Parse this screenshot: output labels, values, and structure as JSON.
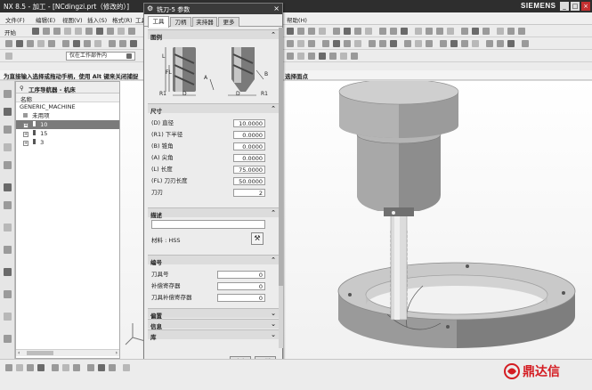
{
  "window": {
    "title": "NX 8.5 - 加工 - [NCdingzi.prt（修改的）]",
    "brand": "SIEMENS",
    "controls": [
      "_",
      "□",
      "×"
    ]
  },
  "menu": {
    "items": [
      "文件(F)",
      "编辑(E)",
      "视图(V)",
      "插入(S)",
      "格式(R)",
      "工具(T)"
    ],
    "help": "帮助(H)"
  },
  "toolbar": {
    "start_label": "开始",
    "selection_scope": "仅在工作部件内"
  },
  "status": {
    "prompt": "为直接输入选择或拖动手柄，使用 Alt 键来关闭捕捉",
    "prompt_right": "选择面点"
  },
  "navigator": {
    "title": "工序导航器 - 机床",
    "column_name": "名称",
    "rows": [
      {
        "label": "GENERIC_MACHINE",
        "expander": "",
        "flag": false,
        "selected": false,
        "indent": 0
      },
      {
        "label": "未用项",
        "expander": "",
        "flag": false,
        "selected": false,
        "indent": 4
      },
      {
        "label": "10",
        "expander": "+",
        "flag": true,
        "selected": true,
        "indent": 4
      },
      {
        "label": "15",
        "expander": "+",
        "flag": true,
        "selected": false,
        "indent": 4
      },
      {
        "label": "3",
        "expander": "+",
        "flag": true,
        "selected": false,
        "indent": 4
      }
    ]
  },
  "dialog": {
    "title": "铣刀-5 参数",
    "tabs": [
      "工具",
      "刀柄",
      "夹持器",
      "更多"
    ],
    "sections": {
      "legend": "图例",
      "size": "尺寸",
      "description": "描述",
      "numbering": "编号",
      "tracking": "偏置",
      "info": "信息",
      "library": "库"
    },
    "diagram_labels": {
      "r1": "R1",
      "d": "D",
      "fl": "FL",
      "l": "L",
      "a": "A",
      "b": "B"
    },
    "size_fields": [
      {
        "label": "(D) 直径",
        "value": "10.0000"
      },
      {
        "label": "(R1) 下半径",
        "value": "0.0000"
      },
      {
        "label": "(B) 锥角",
        "value": "0.0000"
      },
      {
        "label": "(A) 尖角",
        "value": "0.0000"
      },
      {
        "label": "(L) 长度",
        "value": "75.0000"
      },
      {
        "label": "(FL) 刀刃长度",
        "value": "50.0000"
      },
      {
        "label": "刀刃",
        "value": "2"
      }
    ],
    "material_label": "材料 : HSS",
    "number_fields": [
      {
        "label": "刀具号",
        "value": "0"
      },
      {
        "label": "补偿寄存器",
        "value": "0"
      },
      {
        "label": "刀具补偿寄存器",
        "value": "0"
      }
    ],
    "ok_label": "确定",
    "cancel_label": "取消"
  },
  "watermark": {
    "text": "鼎达信",
    "color": "#d41c22"
  }
}
